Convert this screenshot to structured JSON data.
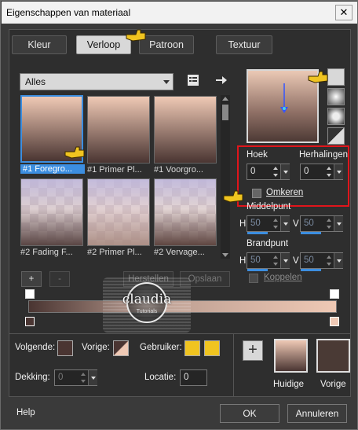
{
  "window": {
    "title": "Eigenschappen van materiaal",
    "close_glyph": "✕"
  },
  "tabs": [
    {
      "label": "Kleur",
      "active": false
    },
    {
      "label": "Verloop",
      "active": true
    },
    {
      "label": "Patroon",
      "active": false
    },
    {
      "label": "Textuur",
      "active": false
    }
  ],
  "gallery": {
    "category": "Alles",
    "items": [
      {
        "label": "#1 Foregro...",
        "selected": true
      },
      {
        "label": "#1 Primer Pl...",
        "selected": false
      },
      {
        "label": "#1 Voorgro...",
        "selected": false
      },
      {
        "label": "#2 Fading F...",
        "selected": false
      },
      {
        "label": "#2 Primer Pl...",
        "selected": false
      },
      {
        "label": "#2 Vervage...",
        "selected": false
      }
    ],
    "add_glyph": "+",
    "remove_glyph": "-",
    "restore_label": "Herstellen",
    "save_label": "Opslaan"
  },
  "gradient_settings": {
    "angle_label": "Hoek",
    "angle_value": "0",
    "repeats_label": "Herhalingen",
    "repeats_value": "0",
    "invert_label": "Omkeren",
    "invert_checked": false,
    "midpoint_label": "Middelpunt",
    "midpoint_h_label": "H",
    "midpoint_h_value": "50",
    "midpoint_v_label": "V",
    "midpoint_v_value": "50",
    "focal_label": "Brandpunt",
    "focal_h_label": "H",
    "focal_h_value": "50",
    "focal_v_label": "V",
    "focal_v_value": "50",
    "link_label": "Koppelen"
  },
  "stops": {
    "next_label": "Volgende:",
    "prev_label": "Vorige:",
    "user_label": "Gebruiker:",
    "opacity_label": "Dekking:",
    "opacity_value": "0",
    "location_label": "Locatie:",
    "location_value": "0"
  },
  "current": {
    "current_label": "Huidige",
    "previous_label": "Vorige",
    "add_glyph": "+"
  },
  "footer": {
    "help_label": "Help",
    "ok_label": "OK",
    "cancel_label": "Annuleren"
  },
  "watermark": {
    "name": "claudia",
    "subtitle": "Tutorials"
  },
  "colors": {
    "foreground": "#4a3532",
    "background": "#efc9b5",
    "accent": "#3c8ee0",
    "highlight_box": "#e0151b",
    "user_color": "#f0c420"
  }
}
